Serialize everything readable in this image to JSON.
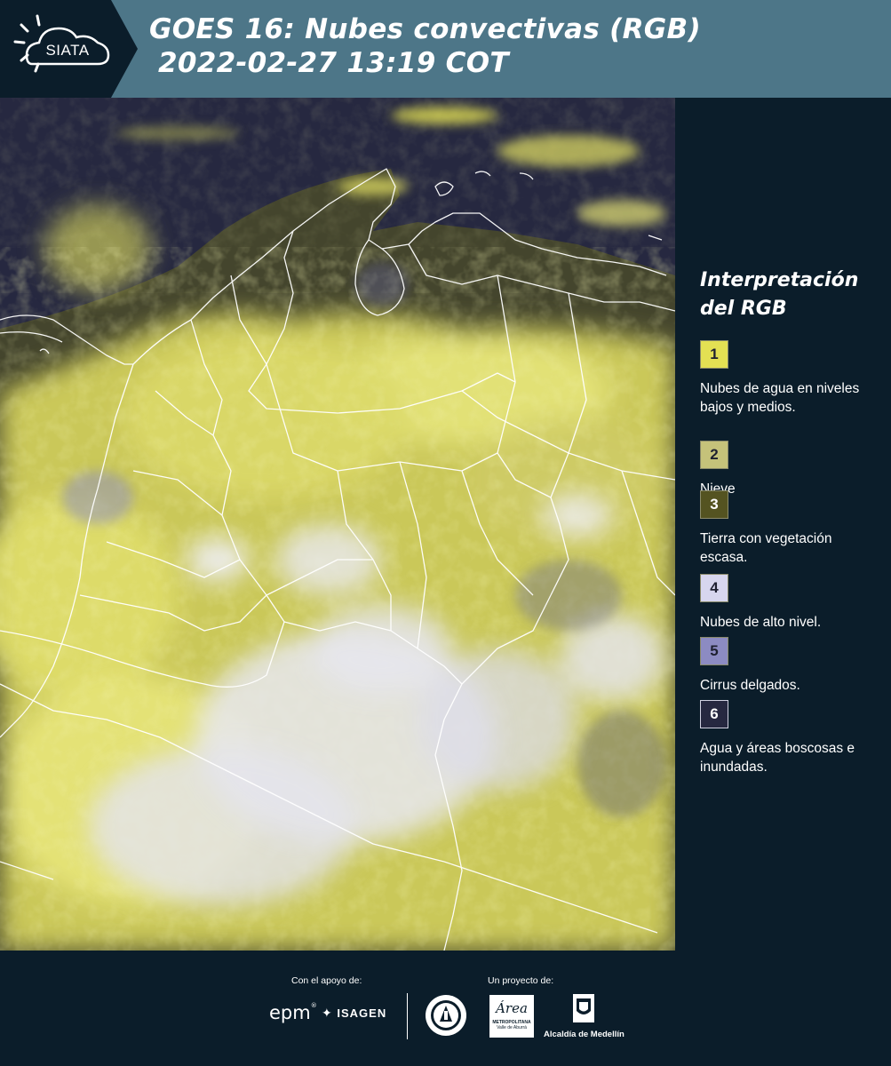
{
  "header": {
    "logo_text": "SIATA",
    "title_line1": "GOES 16: Nubes convectivas (RGB)",
    "title_line2": "2022-02-27 13:19 COT"
  },
  "map": {
    "description_icon": "satellite-rgb-image",
    "colors": {
      "ocean": "#262840",
      "cloud_yellow": "#e7e56a",
      "cloud_white": "#e6e6f0",
      "borders": "#ffffff"
    }
  },
  "legend": {
    "title": "Interpretación del RGB",
    "items": [
      {
        "number": "1",
        "color": "#e3e053",
        "text": "Nubes de agua en niveles bajos y medios."
      },
      {
        "number": "2",
        "color": "#c5c27a",
        "text": "Nieve"
      },
      {
        "number": "3",
        "color": "#545321",
        "text": "Tierra con vegetación escasa."
      },
      {
        "number": "4",
        "color": "#d7d6ee",
        "text": "Nubes de alto nivel."
      },
      {
        "number": "5",
        "color": "#8c8bc2",
        "text": "Cirrus delgados."
      },
      {
        "number": "6",
        "color": "#262840",
        "text": "Agua y áreas boscosas e inundadas."
      }
    ]
  },
  "footer": {
    "support_label": "Con el apoyo de:",
    "project_label": "Un proyecto de:",
    "epm": "epm",
    "isagen": "ISAGEN",
    "metropolitana": "METROPOLITANA",
    "valle": "Valle de Aburrá",
    "area": "Área",
    "alcaldia": "Alcaldía de Medellín"
  }
}
